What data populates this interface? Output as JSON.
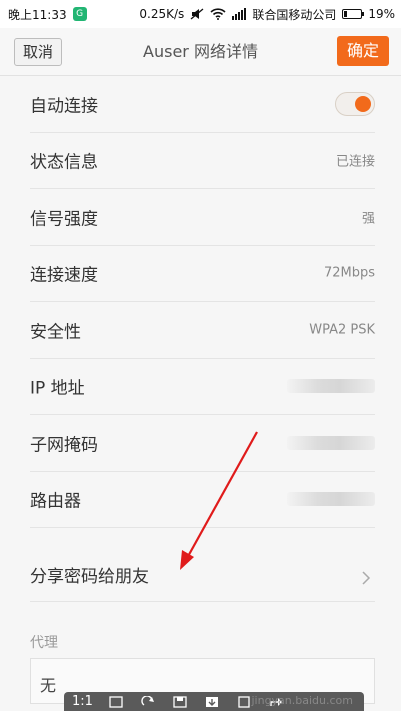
{
  "statusbar": {
    "time": "晚上11:33",
    "app_badge": "G",
    "speed": "0.25K/s",
    "carrier": "联合国移动公司",
    "battery_percent_text": "19%",
    "battery_level": 0.19
  },
  "header": {
    "cancel_label": "取消",
    "title": "Auser 网络详情",
    "confirm_label": "确定"
  },
  "rows": [
    {
      "label": "自动连接",
      "value": ""
    },
    {
      "label": "状态信息",
      "value": "已连接"
    },
    {
      "label": "信号强度",
      "value": "强"
    },
    {
      "label": "连接速度",
      "value": "72Mbps"
    },
    {
      "label": "安全性",
      "value": "WPA2 PSK"
    },
    {
      "label": "IP 地址",
      "value": ""
    },
    {
      "label": "子网掩码",
      "value": ""
    },
    {
      "label": "路由器",
      "value": ""
    },
    {
      "label": "分享密码给朋友",
      "value": ""
    }
  ],
  "auto_connect_on": true,
  "proxy": {
    "section_label": "代理",
    "value": "无"
  },
  "overlay": {
    "zoom_label": "1:1",
    "watermark": "jingyan.baidu.com"
  },
  "colors": {
    "accent": "#f26a1b"
  }
}
